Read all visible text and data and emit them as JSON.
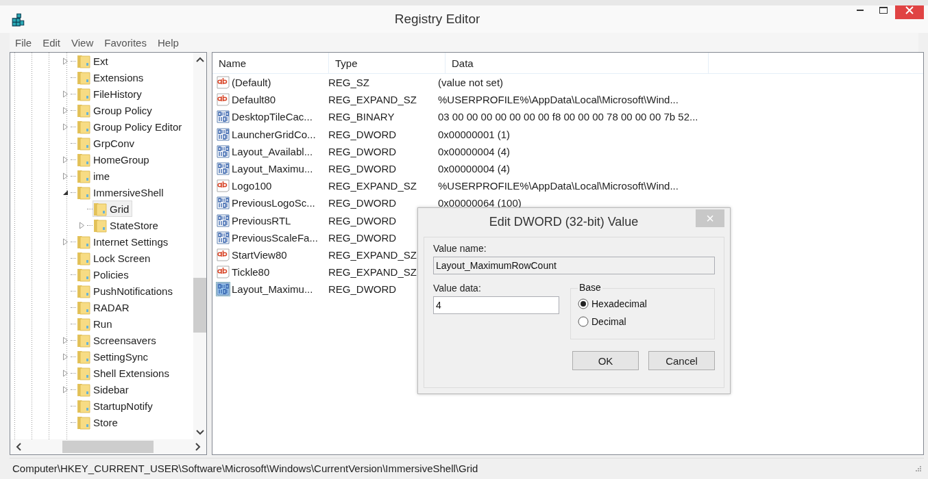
{
  "window": {
    "title": "Registry Editor"
  },
  "menu": [
    "File",
    "Edit",
    "View",
    "Favorites",
    "Help"
  ],
  "tree": [
    {
      "label": "Ext",
      "kind": "branch",
      "expanded": false,
      "selected": false
    },
    {
      "label": "Extensions",
      "kind": "leaf",
      "selected": false
    },
    {
      "label": "FileHistory",
      "kind": "branch",
      "expanded": false,
      "selected": false
    },
    {
      "label": "Group Policy",
      "kind": "branch",
      "expanded": false,
      "selected": false
    },
    {
      "label": "Group Policy Editor",
      "kind": "branch",
      "expanded": false,
      "selected": false
    },
    {
      "label": "GrpConv",
      "kind": "leaf",
      "selected": false
    },
    {
      "label": "HomeGroup",
      "kind": "branch",
      "expanded": false,
      "selected": false
    },
    {
      "label": "ime",
      "kind": "branch",
      "expanded": false,
      "selected": false
    },
    {
      "label": "ImmersiveShell",
      "kind": "branch",
      "expanded": true,
      "selected": false,
      "children": [
        {
          "label": "Grid",
          "kind": "leaf",
          "selected": true
        },
        {
          "label": "StateStore",
          "kind": "branch",
          "expanded": false,
          "selected": false
        }
      ]
    },
    {
      "label": "Internet Settings",
      "kind": "branch",
      "expanded": false,
      "selected": false
    },
    {
      "label": "Lock Screen",
      "kind": "leaf",
      "selected": false
    },
    {
      "label": "Policies",
      "kind": "leaf",
      "selected": false
    },
    {
      "label": "PushNotifications",
      "kind": "leaf",
      "selected": false
    },
    {
      "label": "RADAR",
      "kind": "leaf",
      "selected": false
    },
    {
      "label": "Run",
      "kind": "leaf",
      "selected": false
    },
    {
      "label": "Screensavers",
      "kind": "branch",
      "expanded": false,
      "selected": false
    },
    {
      "label": "SettingSync",
      "kind": "branch",
      "expanded": false,
      "selected": false
    },
    {
      "label": "Shell Extensions",
      "kind": "branch",
      "expanded": false,
      "selected": false
    },
    {
      "label": "Sidebar",
      "kind": "branch",
      "expanded": false,
      "selected": false
    },
    {
      "label": "StartupNotify",
      "kind": "leaf",
      "selected": false
    },
    {
      "label": "Store",
      "kind": "leaf",
      "selected": false
    }
  ],
  "table": {
    "columns": [
      "Name",
      "Type",
      "Data"
    ],
    "rows": [
      {
        "kind": "string",
        "name": "(Default)",
        "type": "REG_SZ",
        "data": "(value not set)",
        "selected": false
      },
      {
        "kind": "string",
        "name": "Default80",
        "type": "REG_EXPAND_SZ",
        "data": "%USERPROFILE%\\AppData\\Local\\Microsoft\\Wind...",
        "selected": false
      },
      {
        "kind": "binary",
        "name": "DesktopTileCac...",
        "type": "REG_BINARY",
        "data": "03 00 00 00 00 00 00 00 f8 00 00 00 78 00 00 00 7b 52...",
        "selected": false
      },
      {
        "kind": "binary",
        "name": "LauncherGridCo...",
        "type": "REG_DWORD",
        "data": "0x00000001 (1)",
        "selected": false
      },
      {
        "kind": "binary",
        "name": "Layout_Availabl...",
        "type": "REG_DWORD",
        "data": "0x00000004 (4)",
        "selected": false
      },
      {
        "kind": "binary",
        "name": "Layout_Maximu...",
        "type": "REG_DWORD",
        "data": "0x00000004 (4)",
        "selected": false
      },
      {
        "kind": "string",
        "name": "Logo100",
        "type": "REG_EXPAND_SZ",
        "data": "%USERPROFILE%\\AppData\\Local\\Microsoft\\Wind...",
        "selected": false
      },
      {
        "kind": "binary",
        "name": "PreviousLogoSc...",
        "type": "REG_DWORD",
        "data": "0x00000064 (100)",
        "selected": false
      },
      {
        "kind": "binary",
        "name": "PreviousRTL",
        "type": "REG_DWORD",
        "selected": false
      },
      {
        "kind": "binary",
        "name": "PreviousScaleFa...",
        "type": "REG_DWORD",
        "selected": false
      },
      {
        "kind": "string",
        "name": "StartView80",
        "type": "REG_EXPAND_SZ",
        "selected": false
      },
      {
        "kind": "string",
        "name": "Tickle80",
        "type": "REG_EXPAND_SZ",
        "selected": false
      },
      {
        "kind": "binary",
        "name": "Layout_Maximu...",
        "type": "REG_DWORD",
        "selected": true
      }
    ]
  },
  "dialog": {
    "title": "Edit DWORD (32-bit) Value",
    "close": "×",
    "value_name_label": "Value name:",
    "value_name": "Layout_MaximumRowCount",
    "value_data_label": "Value data:",
    "value_data": "4",
    "base_label": "Base",
    "base_options": [
      {
        "label": "Hexadecimal",
        "selected": true
      },
      {
        "label": "Decimal",
        "selected": false
      }
    ],
    "buttons": [
      "OK",
      "Cancel"
    ]
  },
  "status_bar": "Computer\\HKEY_CURRENT_USER\\Software\\Microsoft\\Windows\\CurrentVersion\\ImmersiveShell\\Grid"
}
